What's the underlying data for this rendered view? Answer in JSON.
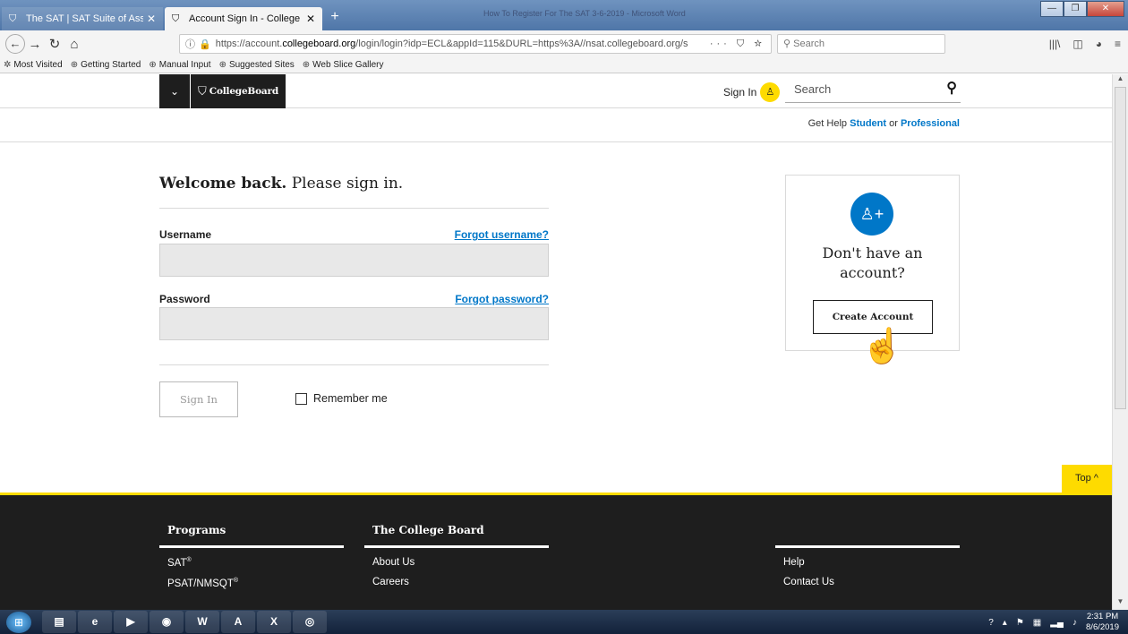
{
  "browser": {
    "tabs": [
      {
        "title": "The SAT | SAT Suite of Assessm",
        "active": false
      },
      {
        "title": "Account Sign In - College Boar",
        "active": true
      }
    ],
    "new_tab_label": "+",
    "window_title": "How To Register For The SAT 3-6-2019 - Microsoft Word",
    "url_prefix": "https://account.",
    "url_domain": "collegeboard.org",
    "url_rest": "/login/login?idp=ECL&appId=115&DURL=https%3A//nsat.collegeboard.org/s",
    "url_actions": "··· ⛉ ☆",
    "search_placeholder": "Search",
    "bookmarks": [
      "Most Visited",
      "Getting Started",
      "Manual Input",
      "Suggested Sites",
      "Web Slice Gallery"
    ]
  },
  "header": {
    "logo_text": "CollegeBoard",
    "signin_label": "Sign In",
    "search_placeholder": "Search",
    "help_prefix": "Get Help",
    "help_student": "Student",
    "help_or": "or",
    "help_professional": "Professional"
  },
  "signin": {
    "title_bold": "Welcome back.",
    "title_rest": " Please sign in.",
    "username_label": "Username",
    "forgot_username": "Forgot username?",
    "username_value": "",
    "password_label": "Password",
    "forgot_password": "Forgot password?",
    "password_value": "",
    "signin_button": "Sign In",
    "remember_label": "Remember me"
  },
  "account": {
    "question_line1": "Don't have an",
    "question_line2": "account?",
    "create_button": "Create Account"
  },
  "top_button": "Top ^",
  "footer": {
    "programs_heading": "Programs",
    "programs": [
      {
        "name": "SAT",
        "mark": "®"
      },
      {
        "name": "PSAT/NMSQT",
        "mark": "®"
      }
    ],
    "cb_heading": "The College Board",
    "cb_links": [
      "About Us",
      "Careers"
    ],
    "help_links": [
      "Help",
      "Contact Us"
    ]
  },
  "taskbar": {
    "time": "2:31 PM",
    "date": "8/6/2019"
  },
  "colors": {
    "accent_yellow": "#fedb00",
    "link_blue": "#0077c8",
    "dark": "#1e1e1e"
  }
}
